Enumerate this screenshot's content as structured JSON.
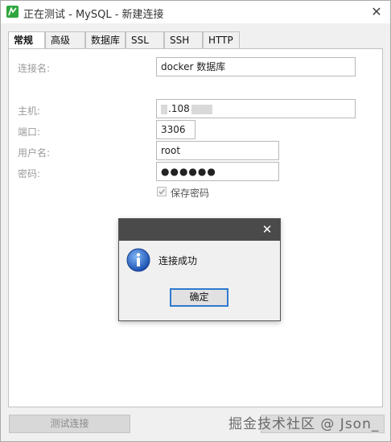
{
  "window": {
    "title": "正在测试 - MySQL - 新建连接",
    "close_glyph": "✕"
  },
  "tabs": [
    {
      "label": "常规",
      "active": true
    },
    {
      "label": "高级",
      "active": false
    },
    {
      "label": "数据库",
      "active": false
    },
    {
      "label": "SSL",
      "active": false
    },
    {
      "label": "SSH",
      "active": false
    },
    {
      "label": "HTTP",
      "active": false
    }
  ],
  "form": {
    "connection_name_label": "连接名:",
    "connection_name_value": "docker 数据库",
    "host_label": "主机:",
    "host_value_visible": ".108",
    "port_label": "端口:",
    "port_value": "3306",
    "username_label": "用户名:",
    "username_value": "root",
    "password_label": "密码:",
    "password_value": "●●●●●●",
    "save_password_label": "保存密码",
    "save_password_checked": true
  },
  "footer": {
    "test_button_label": "测试连接",
    "watermark": "掘金技术社区 @ Json_"
  },
  "dialog": {
    "close_glyph": "✕",
    "icon": "info-icon",
    "message": "连接成功",
    "ok_label": "确定"
  },
  "colors": {
    "dialog_titlebar": "#4a4a4a",
    "ok_button_border": "#2f79d0",
    "app_icon": "#2fa63d"
  }
}
